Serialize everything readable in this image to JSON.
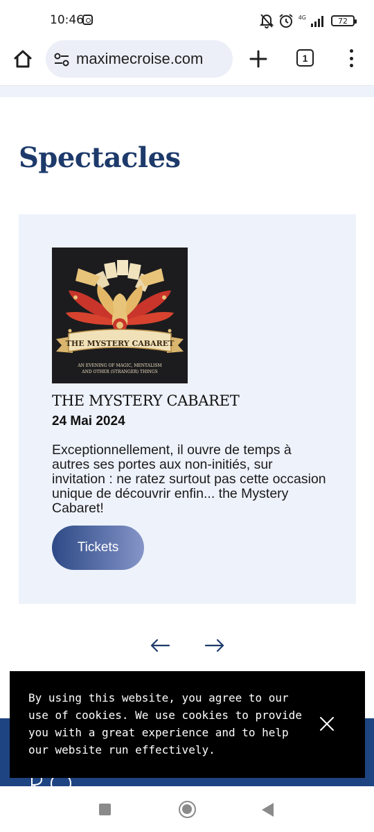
{
  "status_bar": {
    "time": "10:46",
    "network": "4G",
    "battery": "72",
    "icons": [
      "instagram-icon",
      "bell-off-icon",
      "alarm-icon",
      "signal-icon",
      "battery-icon"
    ]
  },
  "browser": {
    "url": "maximecroise.com",
    "tab_count": "1",
    "icons": [
      "home-icon",
      "site-settings-icon",
      "new-tab-icon",
      "tabs-icon",
      "menu-icon"
    ]
  },
  "page": {
    "heading": "Spectacles"
  },
  "show": {
    "title": "THE MYSTERY CABARET",
    "date": "24 Mai 2024",
    "description": "Exceptionnellement, il ouvre de temps à autres ses portes aux non-initiés, sur invitation : ne ratez surtout pas cette occasion unique de découvrir enfin... the Mystery Cabaret!",
    "button_label": "Tickets",
    "poster": {
      "banner_text": "THE MYSTERY CABARET",
      "tagline_line1": "AN EVENING OF MAGIC, MENTALISM",
      "tagline_line2": "AND OTHER (STRANGER) THINGS"
    }
  },
  "carousel": {
    "prev_icon": "arrow-left-icon",
    "next_icon": "arrow-right-icon"
  },
  "cookie_banner": {
    "text": "By using this website, you agree to our use of cookies. We use cookies to provide you with a great experience and to help our website run effectively.",
    "close_icon": "close-icon"
  },
  "colors": {
    "heading_blue": "#1d3a6b",
    "card_background": "#eef2fb",
    "footer_blue": "#1e4582",
    "button_gradient_start": "#2e4a86",
    "button_gradient_end": "#8695c8"
  }
}
